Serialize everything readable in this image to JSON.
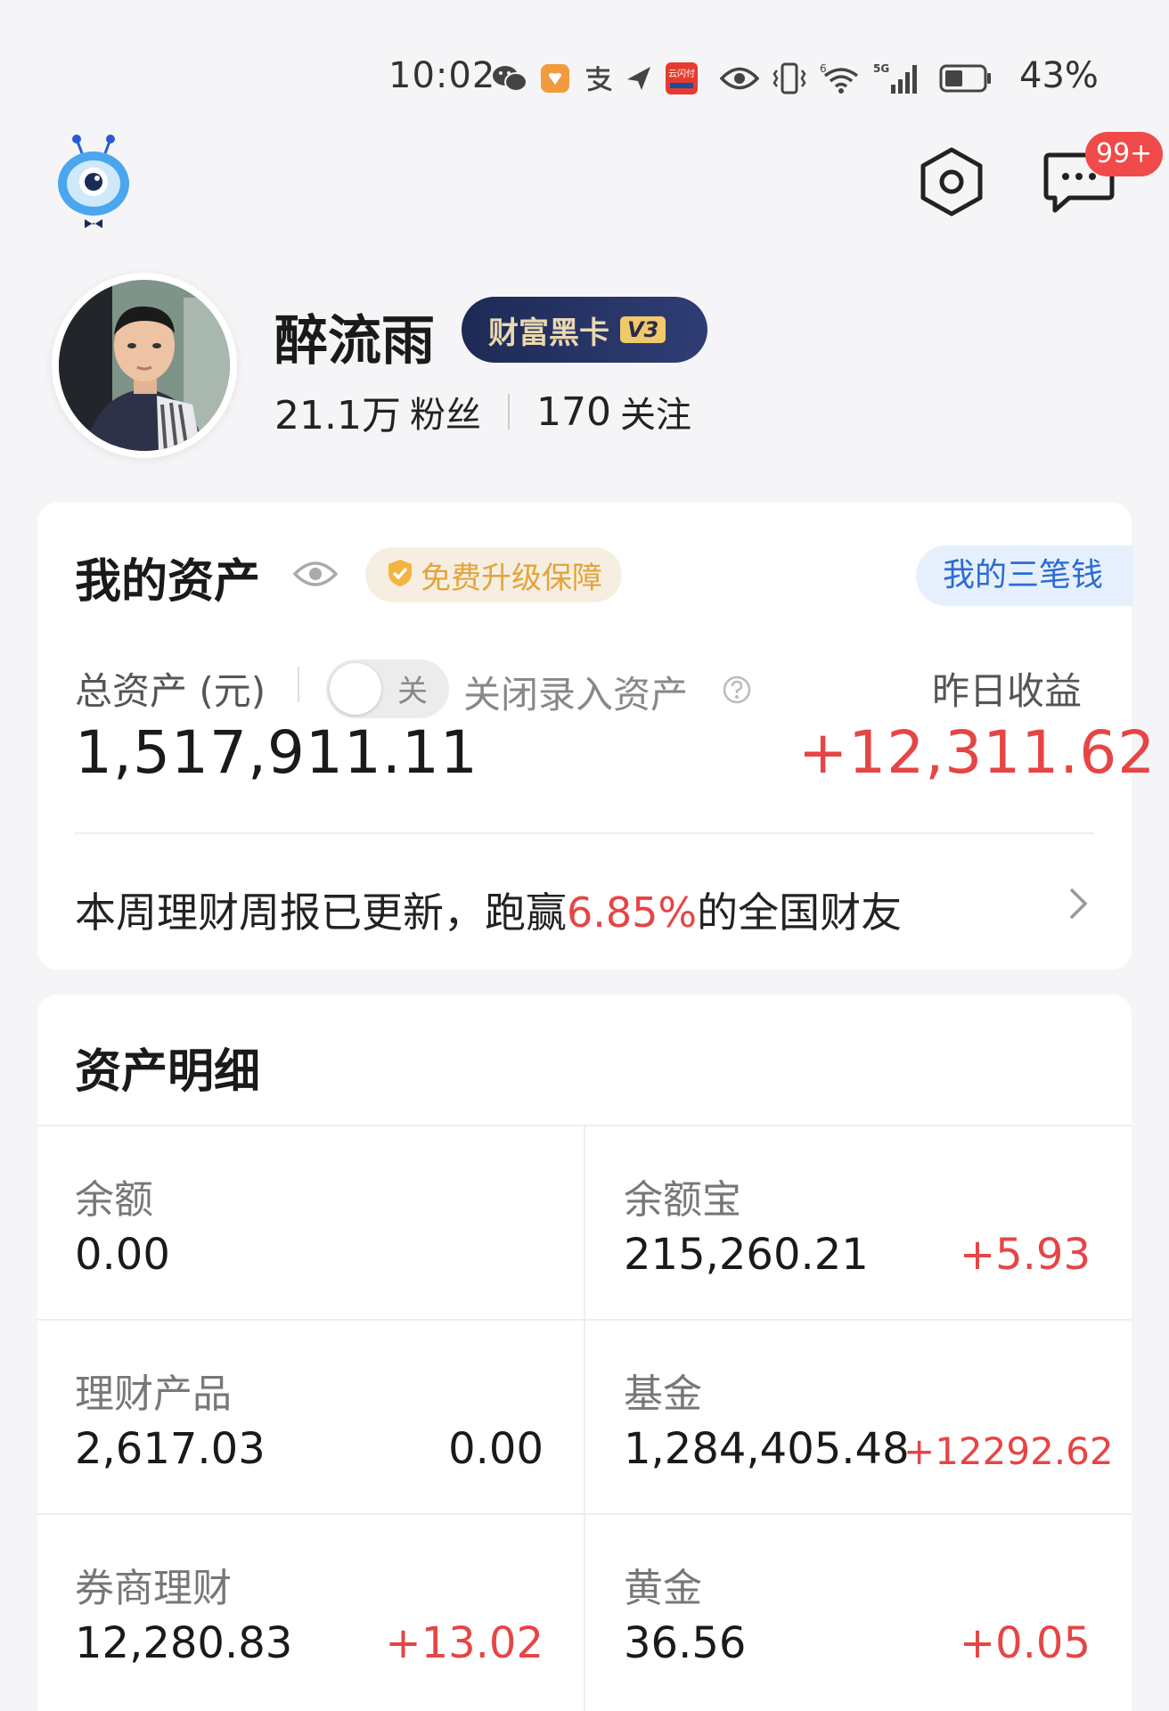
{
  "status_bar": {
    "time": "10:02",
    "battery": "43%",
    "icons": [
      "wechat-icon",
      "app-badge-icon",
      "alipay-icon",
      "send-icon",
      "yunshanfu-icon",
      "eye-icon",
      "vibrate-icon",
      "wifi-icon",
      "signal-5g-icon",
      "battery-icon"
    ],
    "signal_label": "5G",
    "wifi_label": "6",
    "yunshanfu_label": "云闪付"
  },
  "header": {
    "message_badge": "99+"
  },
  "profile": {
    "name": "醉流雨",
    "vip_label": "财富黑卡",
    "vip_level": "V3",
    "followers_count": "21.1万",
    "followers_label": "粉丝",
    "following_count": "170",
    "following_label": "关注"
  },
  "assets_card": {
    "title": "我的资产",
    "upgrade_label": "免费升级保障",
    "three_money_label": "我的三笔钱",
    "total_label": "总资产 (元)",
    "toggle_label": "关",
    "close_entry_label": "关闭录入资产",
    "yesterday_label": "昨日收益",
    "total_value": "1,517,911.11",
    "yesterday_value": "+12,311.62",
    "weekly_prefix": "本周理财周报已更新，跑赢",
    "weekly_pct": "6.85%",
    "weekly_suffix": "的全国财友"
  },
  "detail_card": {
    "title": "资产明细",
    "cells": [
      {
        "label": "余额",
        "value": "0.00",
        "change": ""
      },
      {
        "label": "余额宝",
        "value": "215,260.21",
        "change": "+5.93"
      },
      {
        "label": "理财产品",
        "value": "2,617.03",
        "change": "0.00"
      },
      {
        "label": "基金",
        "value": "1,284,405.48",
        "change": "+12292.62"
      },
      {
        "label": "券商理财",
        "value": "12,280.83",
        "change": "+13.02"
      },
      {
        "label": "黄金",
        "value": "36.56",
        "change": "+0.05"
      }
    ]
  },
  "colors": {
    "red": "#e64545",
    "blue": "#2b6bd6",
    "gold": "#e3a43a",
    "vip_bg": "#1e2a55"
  }
}
